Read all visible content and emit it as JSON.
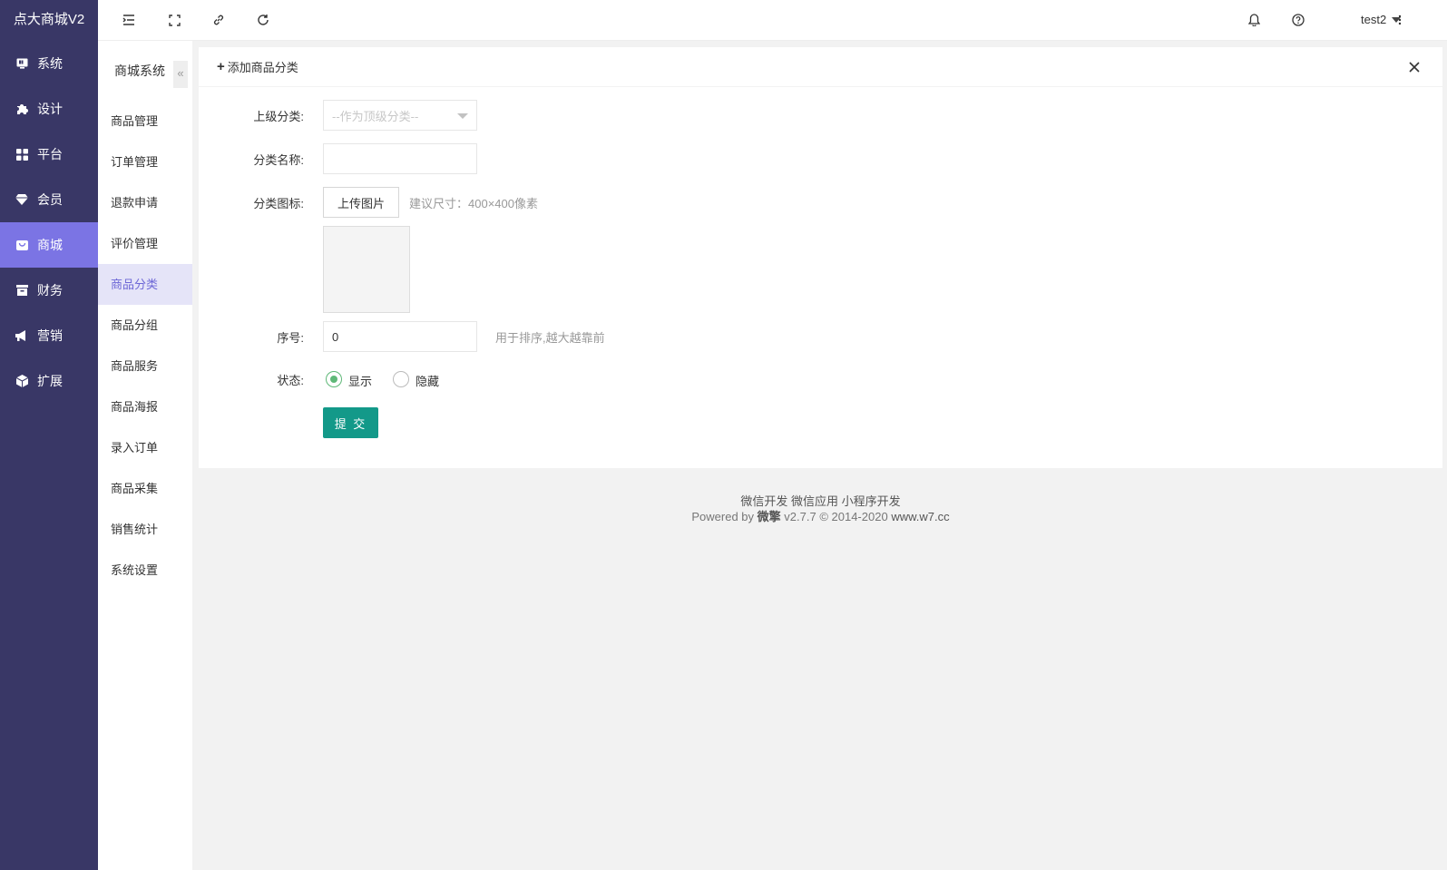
{
  "app": {
    "logo": "点大商城V2"
  },
  "nav": [
    {
      "label": "系统",
      "icon": "monitor-icon"
    },
    {
      "label": "设计",
      "icon": "puzzle-icon"
    },
    {
      "label": "平台",
      "icon": "grid-icon"
    },
    {
      "label": "会员",
      "icon": "diamond-icon"
    },
    {
      "label": "商城",
      "icon": "shop-icon",
      "active": true
    },
    {
      "label": "财务",
      "icon": "wallet-icon"
    },
    {
      "label": "营销",
      "icon": "megaphone-icon"
    },
    {
      "label": "扩展",
      "icon": "cube-icon"
    }
  ],
  "topbar": {
    "user": "test2"
  },
  "submenu": {
    "title": "商城系统",
    "collapse": "«",
    "items": [
      "商品管理",
      "订单管理",
      "退款申请",
      "评价管理",
      "商品分类",
      "商品分组",
      "商品服务",
      "商品海报",
      "录入订单",
      "商品采集",
      "销售统计",
      "系统设置"
    ],
    "active": "商品分类"
  },
  "form": {
    "title": "添加商品分类",
    "parent_label": "上级分类:",
    "parent_placeholder": "--作为顶级分类--",
    "name_label": "分类名称:",
    "name_value": "",
    "icon_label": "分类图标:",
    "upload_label": "上传图片",
    "upload_hint": "建议尺寸：400×400像素",
    "order_label": "序号:",
    "order_value": "0",
    "order_hint": "用于排序,越大越靠前",
    "status_label": "状态:",
    "status_show": "显示",
    "status_hide": "隐藏",
    "status_selected": "显示",
    "submit": "提 交"
  },
  "footer": {
    "links": "微信开发 微信应用 小程序开发",
    "powered_prefix": "Powered by",
    "brand": "微擎",
    "version": "v2.7.7 © 2014-2020",
    "site": "www.w7.cc"
  },
  "colors": {
    "sidebar": "#393766",
    "accent": "#7b74e4",
    "submit": "#139989",
    "radio": "#5fb878"
  }
}
